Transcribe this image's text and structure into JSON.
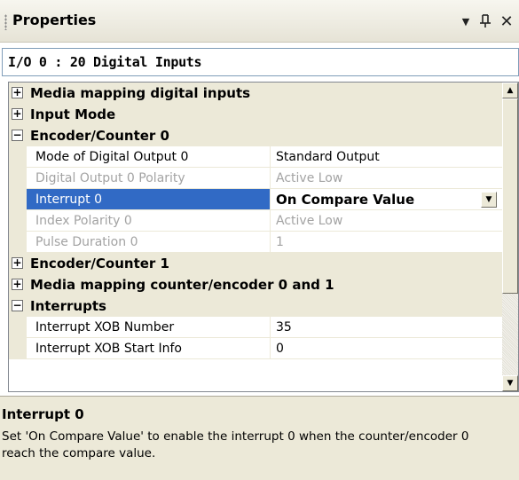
{
  "panel": {
    "title": "Properties",
    "dropdown_glyph": "▼",
    "pin_glyph": "Ҏ",
    "close_glyph": "✕"
  },
  "object_selector": {
    "value": "I/O 0 : 20 Digital Inputs"
  },
  "grid": {
    "rows": [
      {
        "kind": "category",
        "expanded": false,
        "label": "Media mapping digital inputs"
      },
      {
        "kind": "category",
        "expanded": false,
        "label": "Input Mode"
      },
      {
        "kind": "category",
        "expanded": true,
        "label": "Encoder/Counter 0"
      },
      {
        "kind": "property",
        "name": "Mode of Digital Output 0",
        "value": "Standard Output",
        "enabled": true
      },
      {
        "kind": "property",
        "name": "Digital Output 0 Polarity",
        "value": "Active Low",
        "enabled": false
      },
      {
        "kind": "property",
        "name": "Interrupt 0",
        "value": "On Compare Value",
        "enabled": true,
        "selected": true
      },
      {
        "kind": "property",
        "name": "Index Polarity 0",
        "value": "Active Low",
        "enabled": false
      },
      {
        "kind": "property",
        "name": "Pulse Duration 0",
        "value": "1",
        "enabled": false
      },
      {
        "kind": "category",
        "expanded": false,
        "label": "Encoder/Counter 1"
      },
      {
        "kind": "category",
        "expanded": false,
        "label": "Media mapping counter/encoder 0 and 1"
      },
      {
        "kind": "category",
        "expanded": true,
        "label": "Interrupts"
      },
      {
        "kind": "property",
        "name": "Interrupt XOB Number",
        "value": "35",
        "enabled": true
      },
      {
        "kind": "property",
        "name": "Interrupt XOB Start Info",
        "value": "0",
        "enabled": true
      }
    ],
    "expand_glyph": "+",
    "collapse_glyph": "−"
  },
  "description": {
    "title": "Interrupt 0",
    "text": "Set 'On Compare Value' to enable the interrupt 0 when the counter/encoder 0 reach the compare value."
  },
  "colors": {
    "selection": "#316ac5",
    "category_bg": "#ece9d8",
    "disabled_text": "#a3a3a3"
  }
}
